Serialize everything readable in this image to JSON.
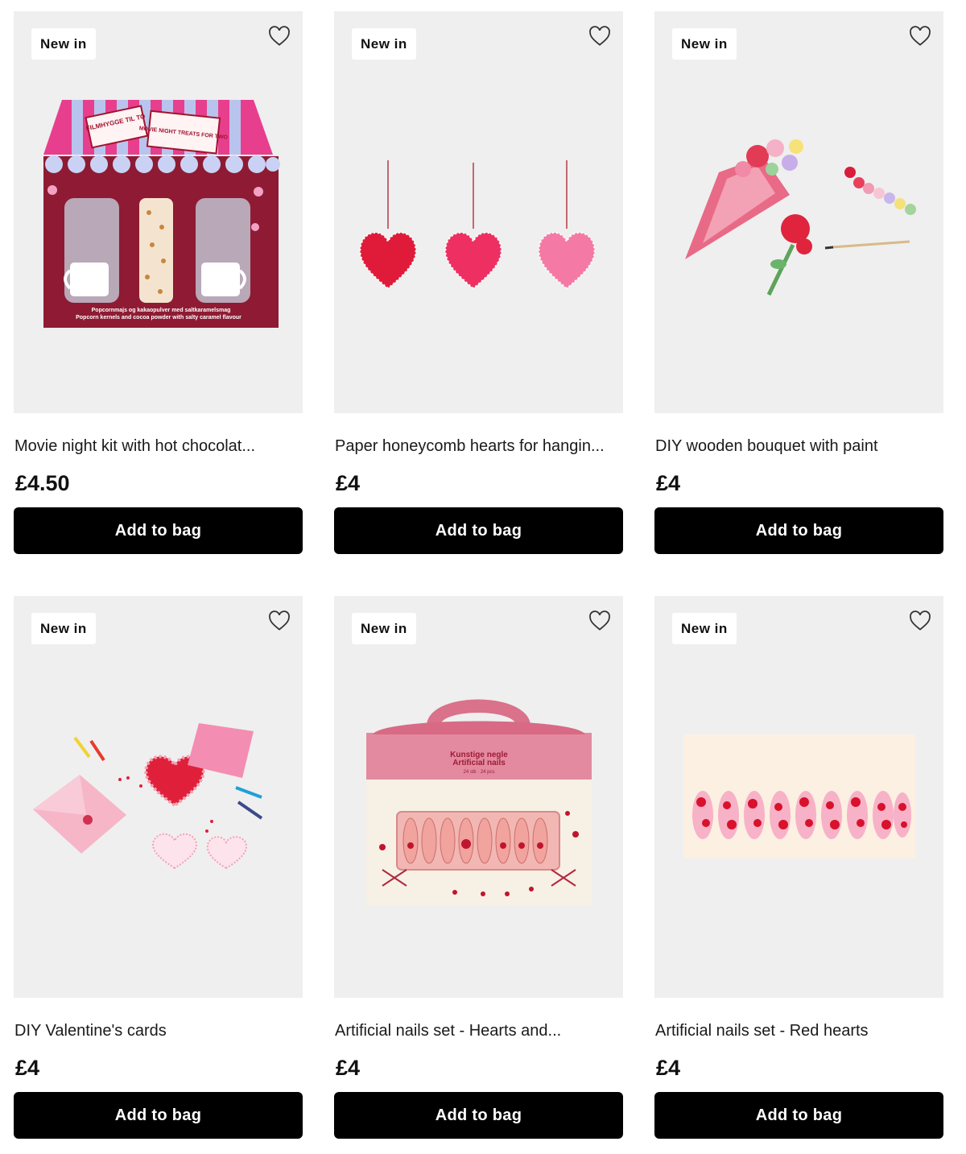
{
  "products": [
    {
      "badge": "New in",
      "title": "Movie night kit with hot chocolat...",
      "price": "£4.50",
      "button": "Add to bag",
      "box_labels": [
        "FILMHYGGE TIL TO",
        "MOVIE NIGHT TREATS FOR TWO"
      ],
      "box_caption_1": "Popcornmajs og kakaopulver med saltkaramelsmag",
      "box_caption_2": "Popcorn kernels and cocoa powder with salty caramel flavour"
    },
    {
      "badge": "New in",
      "title": "Paper honeycomb hearts for hangin...",
      "price": "£4",
      "button": "Add to bag"
    },
    {
      "badge": "New in",
      "title": "DIY wooden bouquet with paint",
      "price": "£4",
      "button": "Add to bag"
    },
    {
      "badge": "New in",
      "title": "DIY Valentine's cards",
      "price": "£4",
      "button": "Add to bag"
    },
    {
      "badge": "New in",
      "title": "Artificial nails set - Hearts and...",
      "price": "£4",
      "button": "Add to bag",
      "box_labels": [
        "Kunstige negle",
        "Artificial nails",
        "24 stk · 24 pcs"
      ]
    },
    {
      "badge": "New in",
      "title": "Artificial nails set - Red hearts",
      "price": "£4",
      "button": "Add to bag"
    }
  ],
  "icons": {
    "wishlist": "heart-outline-icon"
  },
  "colors": {
    "button_bg": "#000000",
    "button_text": "#ffffff",
    "card_bg": "#efefef",
    "badge_bg": "#ffffff"
  }
}
